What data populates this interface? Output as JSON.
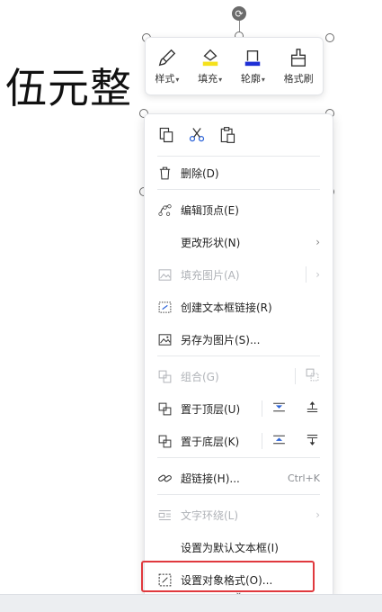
{
  "document": {
    "text": "伍元整"
  },
  "toolbar": {
    "style_label": "样式",
    "fill_label": "填充",
    "outline_label": "轮廓",
    "format_painter_label": "格式刷",
    "fill_color": "#f5e11c",
    "outline_color": "#1e2fd6"
  },
  "menu": {
    "delete": "删除(D)",
    "edit_points": "编辑顶点(E)",
    "change_shape": "更改形状(N)",
    "fill_picture": "填充图片(A)",
    "create_textbox_link": "创建文本框链接(R)",
    "save_as_picture": "另存为图片(S)...",
    "group": "组合(G)",
    "bring_to_front": "置于顶层(U)",
    "send_to_back": "置于底层(K)",
    "hyperlink": "超链接(H)...",
    "hyperlink_shortcut": "Ctrl+K",
    "text_wrap": "文字环绕(L)",
    "set_default_textbox": "设置为默认文本框(I)",
    "format_object": "设置对象格式(O)..."
  },
  "colors": {
    "highlight": "#e0393e",
    "accent_blue": "#2a62d8"
  }
}
